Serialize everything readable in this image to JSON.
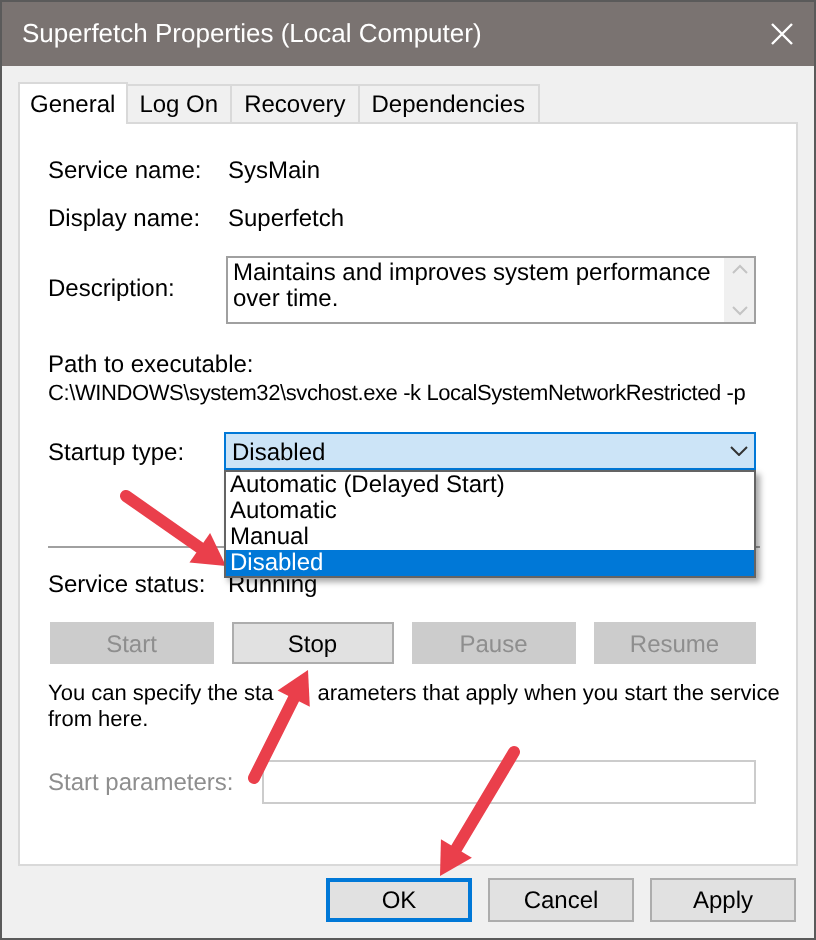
{
  "window": {
    "title": "Superfetch Properties (Local Computer)"
  },
  "tabs": [
    {
      "label": "General",
      "selected": true
    },
    {
      "label": "Log On",
      "selected": false
    },
    {
      "label": "Recovery",
      "selected": false
    },
    {
      "label": "Dependencies",
      "selected": false
    }
  ],
  "service_name": {
    "label": "Service name:",
    "value": "SysMain"
  },
  "display_name": {
    "label": "Display name:",
    "value": "Superfetch"
  },
  "description": {
    "label": "Description:",
    "value": "Maintains and improves system performance over time."
  },
  "path": {
    "label": "Path to executable:",
    "value": "C:\\WINDOWS\\system32\\svchost.exe -k LocalSystemNetworkRestricted -p"
  },
  "startup_type": {
    "label": "Startup type:",
    "value": "Disabled",
    "expanded": true,
    "options": [
      {
        "label": "Automatic (Delayed Start)",
        "selected": false
      },
      {
        "label": "Automatic",
        "selected": false
      },
      {
        "label": "Manual",
        "selected": false
      },
      {
        "label": "Disabled",
        "selected": true
      }
    ]
  },
  "service_status": {
    "label": "Service status:",
    "value": "Running"
  },
  "service_buttons": [
    {
      "label": "Start",
      "disabled": true
    },
    {
      "label": "Stop",
      "disabled": false
    },
    {
      "label": "Pause",
      "disabled": true
    },
    {
      "label": "Resume",
      "disabled": true
    }
  ],
  "hint": [
    "You can specify the sta",
    "arameters that apply when you start the service",
    "from here."
  ],
  "start_parameters": {
    "label": "Start parameters:",
    "disabled": true
  },
  "buttons": [
    {
      "label": "OK",
      "default": true
    },
    {
      "label": "Cancel",
      "default": false
    },
    {
      "label": "Apply",
      "default": false
    }
  ]
}
